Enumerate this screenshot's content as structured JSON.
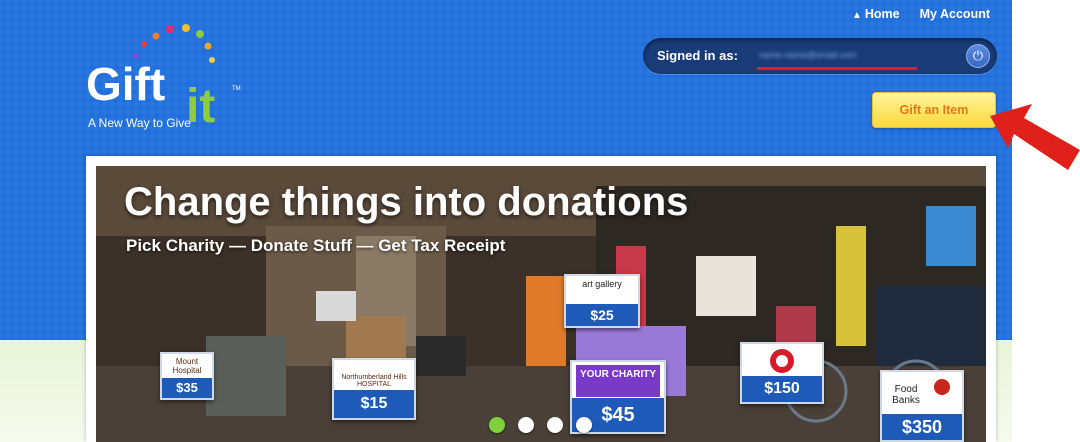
{
  "nav": {
    "home": "Home",
    "my_account": "My Account"
  },
  "logo": {
    "text": "Gift",
    "text2": "it",
    "tm": "TM",
    "tagline": "A New Way to Give"
  },
  "account": {
    "signed_in_label": "Signed in as:",
    "email_masked": "name.name@email.com"
  },
  "gift_button": "Gift an Item",
  "hero": {
    "title": "Change things into donations",
    "subtitle": "Pick Charity — Donate Stuff — Get Tax Receipt",
    "signs": [
      {
        "name": "Mount Hospital",
        "price": "$35"
      },
      {
        "name": "Northumberland Hills HOSPITAL",
        "price": "$15"
      },
      {
        "name": "art gallery",
        "price": "$25"
      },
      {
        "name": "YOUR CHARITY",
        "price": "$45"
      },
      {
        "name": "",
        "price": "$150"
      },
      {
        "name": "Food Banks",
        "price": "$350"
      }
    ],
    "slides": 4,
    "active_slide": 1
  },
  "colors": {
    "header": "#1f6fdc",
    "accent_green": "#7fd13b",
    "gift_button": "#fbd93c",
    "arrow": "#e0201a"
  }
}
